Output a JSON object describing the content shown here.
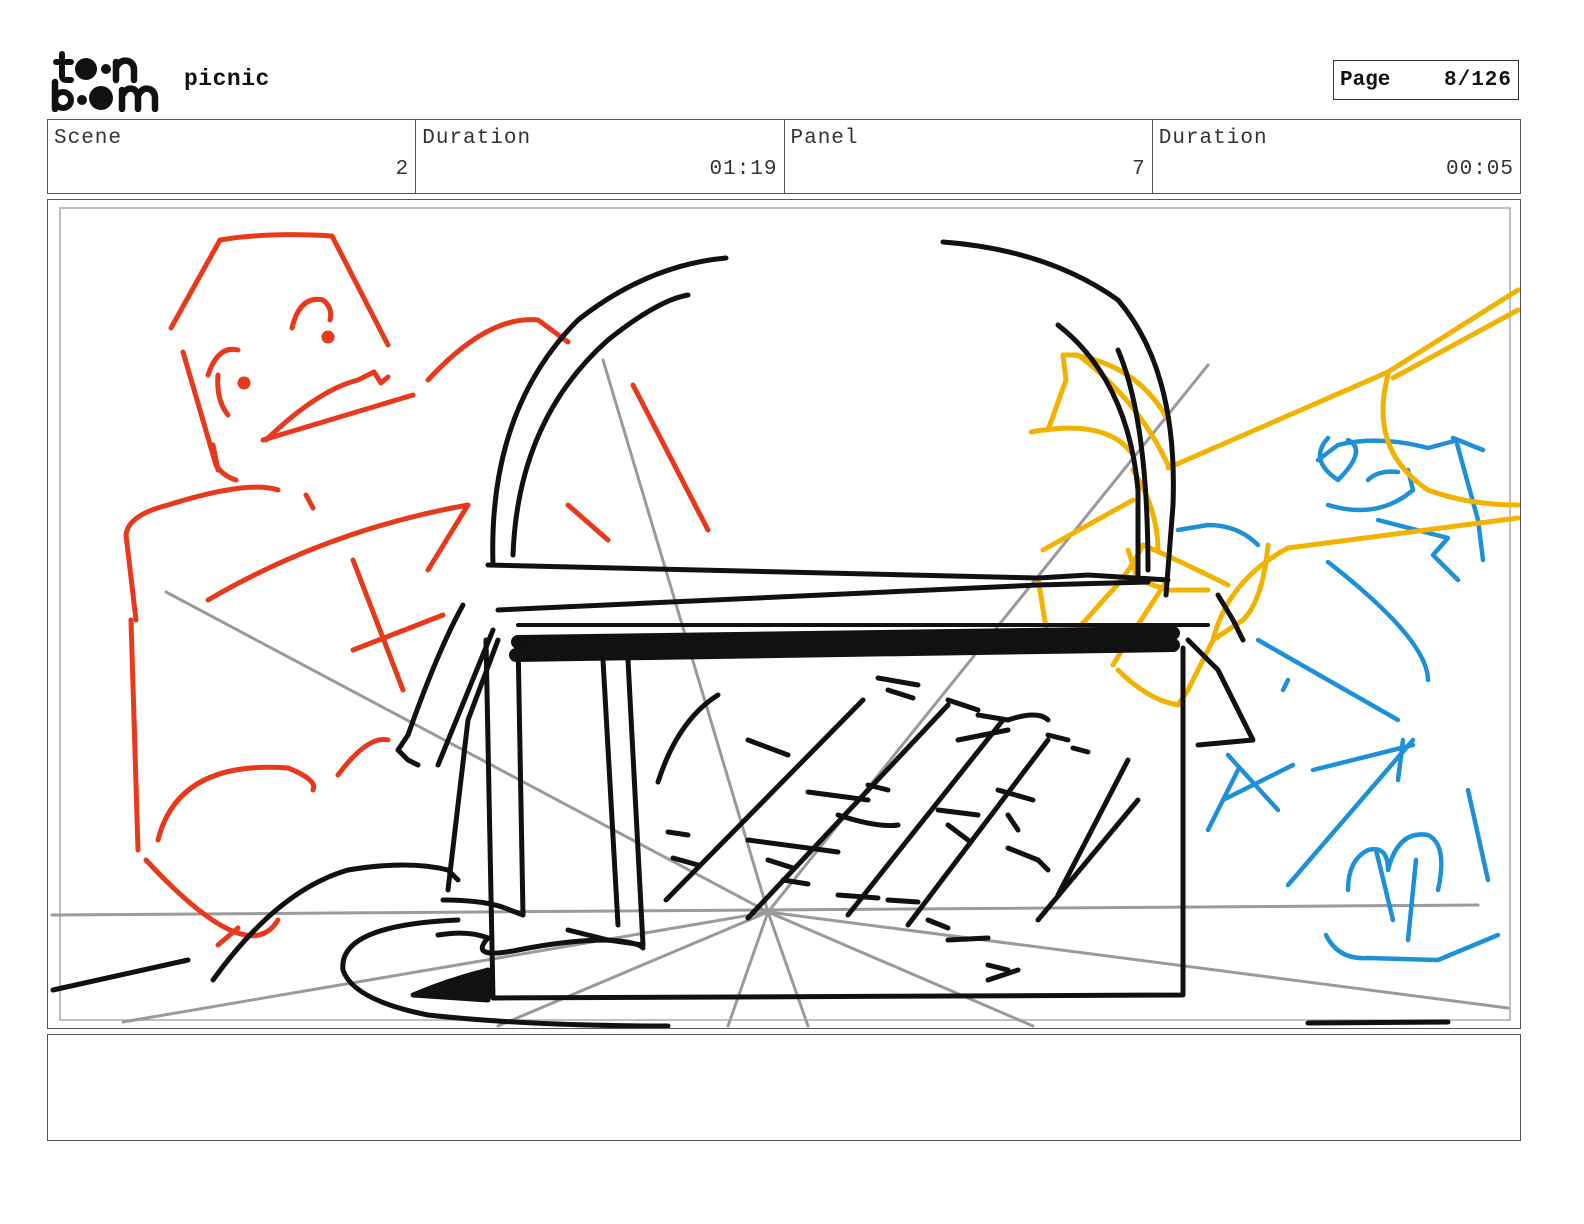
{
  "header": {
    "logo_text": "toon boom",
    "project_title": "picnic",
    "page_label": "Page",
    "page_number": "8/126"
  },
  "info": {
    "scene_label": "Scene",
    "scene_value": "2",
    "scene_duration_label": "Duration",
    "scene_duration_value": "01:19",
    "panel_label": "Panel",
    "panel_value": "7",
    "panel_duration_label": "Duration",
    "panel_duration_value": "00:05"
  },
  "sketch": {
    "colors": {
      "ink": "#111111",
      "red_character": "#e8391d",
      "blue_character": "#1e90d8",
      "yellow_hand": "#f2b200",
      "guide_lines": "#9a9a9a"
    }
  },
  "notes": {
    "text": ""
  }
}
